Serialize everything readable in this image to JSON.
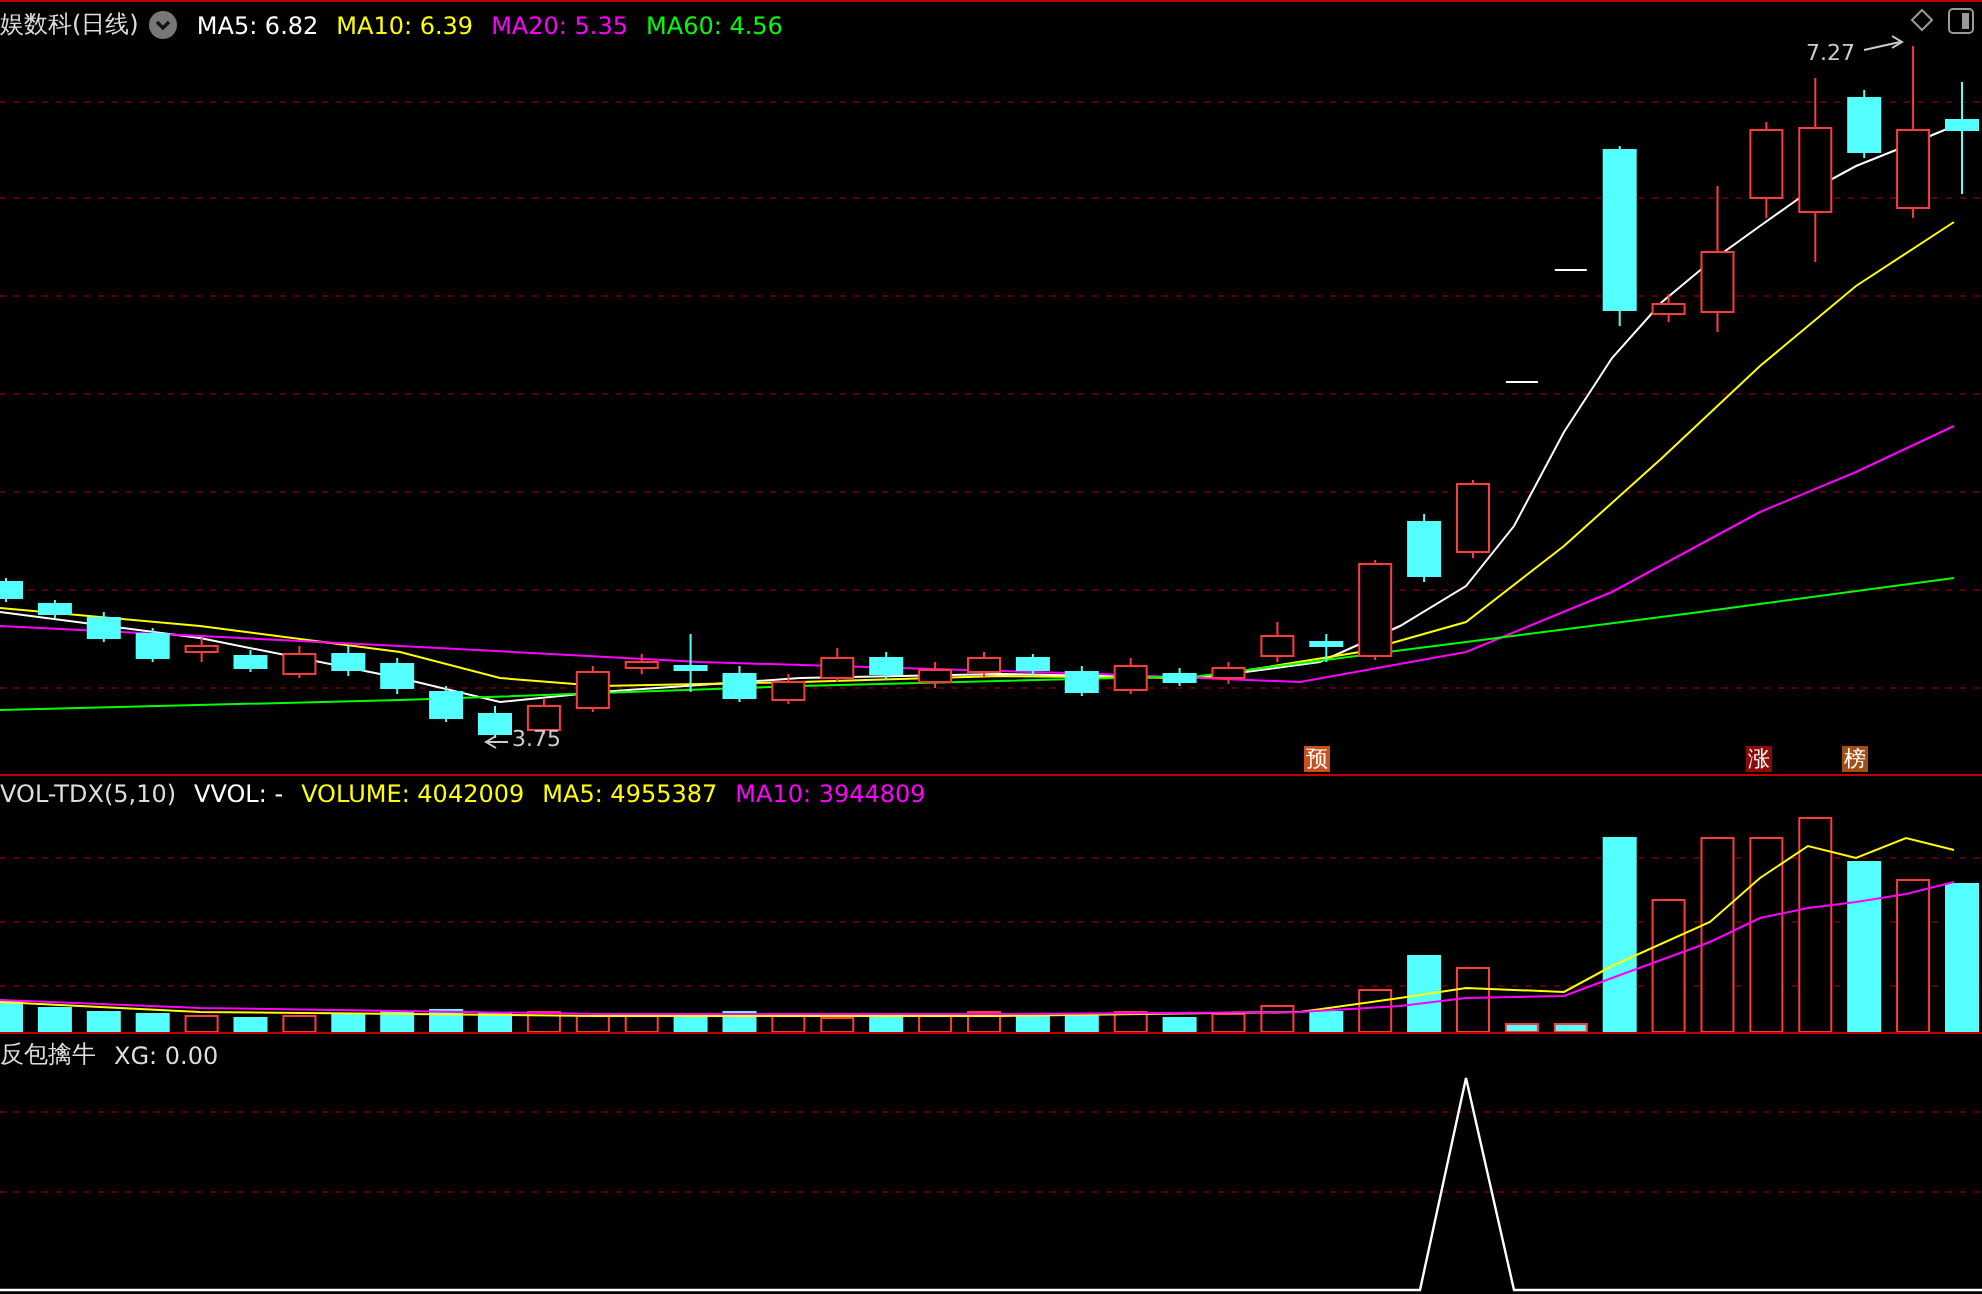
{
  "price_panel": {
    "title": "娱数科(日线)",
    "indicators": [
      {
        "label": "MA5:",
        "value": "6.82",
        "color": "#ffffff"
      },
      {
        "label": "MA10:",
        "value": "6.39",
        "color": "#ffff00"
      },
      {
        "label": "MA20:",
        "value": "5.35",
        "color": "#ff00ff"
      },
      {
        "label": "MA60:",
        "value": "4.56",
        "color": "#00ff00"
      }
    ],
    "high_label": "7.27",
    "low_label": "3.75",
    "signals": [
      {
        "text": "预",
        "color": "#c8501e"
      },
      {
        "text": "涨",
        "color": "#8c0a0a"
      },
      {
        "text": "榜",
        "color": "#a05014"
      }
    ]
  },
  "volume_panel": {
    "indicators": [
      {
        "label": "VOL-TDX(5,10)",
        "color": "#dddddd"
      },
      {
        "label": "VVOL:",
        "value": "-",
        "color": "#ffffff"
      },
      {
        "label": "VOLUME:",
        "value": "4042009",
        "color": "#ffff00"
      },
      {
        "label": "MA5:",
        "value": "4955387",
        "color": "#ffff00"
      },
      {
        "label": "MA10:",
        "value": "3944809",
        "color": "#ff00ff"
      }
    ]
  },
  "signal_panel": {
    "indicators": [
      {
        "label": "反包擒牛",
        "color": "#dddddd"
      },
      {
        "label": "XG:",
        "value": "0.00",
        "color": "#dddddd"
      }
    ]
  }
}
